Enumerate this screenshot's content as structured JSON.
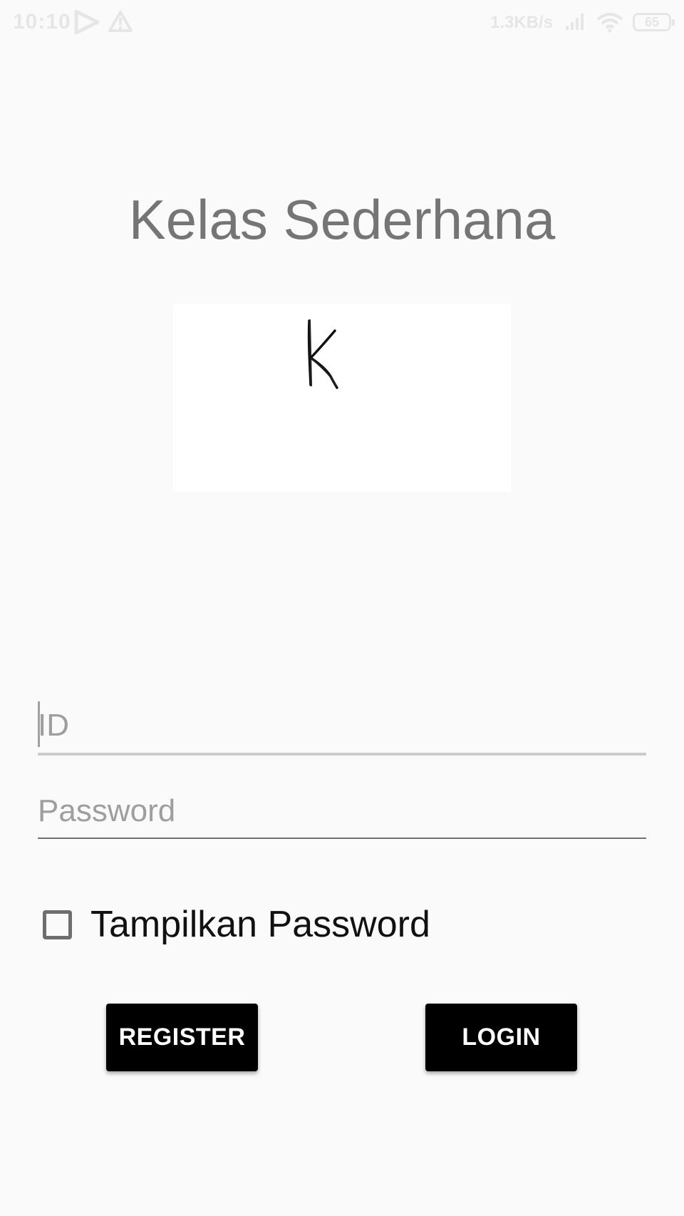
{
  "status_bar": {
    "time": "10:10",
    "network_speed": "1.3KB/s",
    "battery": "65"
  },
  "app": {
    "title": "Kelas Sederhana",
    "logo_letter": "K"
  },
  "form": {
    "id_placeholder": "ID",
    "id_value": "",
    "password_placeholder": "Password",
    "password_value": "",
    "show_password_label": "Tampilkan Password",
    "show_password_checked": false
  },
  "buttons": {
    "register_label": "REGISTER",
    "login_label": "LOGIN"
  },
  "colors": {
    "background": "#fafafa",
    "title": "#757575",
    "button_bg": "#000000",
    "button_text": "#ffffff"
  }
}
